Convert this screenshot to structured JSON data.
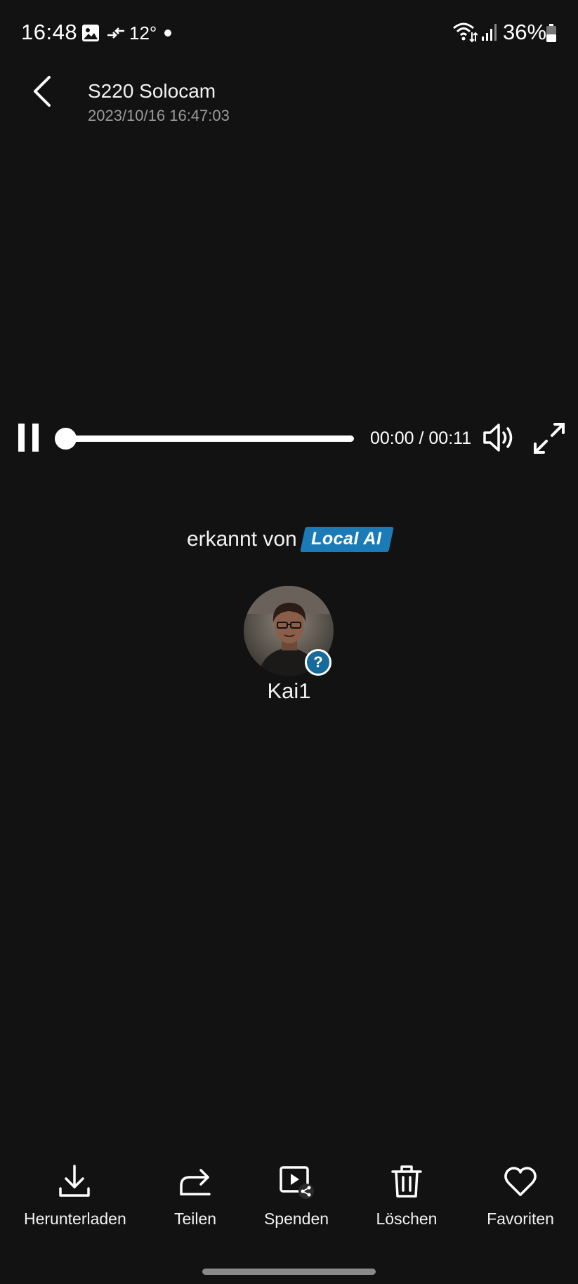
{
  "status_bar": {
    "time": "16:48",
    "temperature": "12°",
    "battery": "36%"
  },
  "header": {
    "title": "S220 Solocam",
    "subtitle": "2023/10/16 16:47:03"
  },
  "player": {
    "time_display": "00:00 / 00:11",
    "progress": 0,
    "state": "playing"
  },
  "detection": {
    "label": "erkannt von",
    "badge": "Local AI",
    "badge_color": "#1b7bb7",
    "person_name": "Kai1",
    "badge_icon": "?"
  },
  "actions": [
    {
      "label": "Herunterladen",
      "icon": "download-icon"
    },
    {
      "label": "Teilen",
      "icon": "share-icon"
    },
    {
      "label": "Spenden",
      "icon": "donate-video-icon"
    },
    {
      "label": "Löschen",
      "icon": "trash-icon"
    },
    {
      "label": "Favoriten",
      "icon": "heart-icon"
    }
  ]
}
